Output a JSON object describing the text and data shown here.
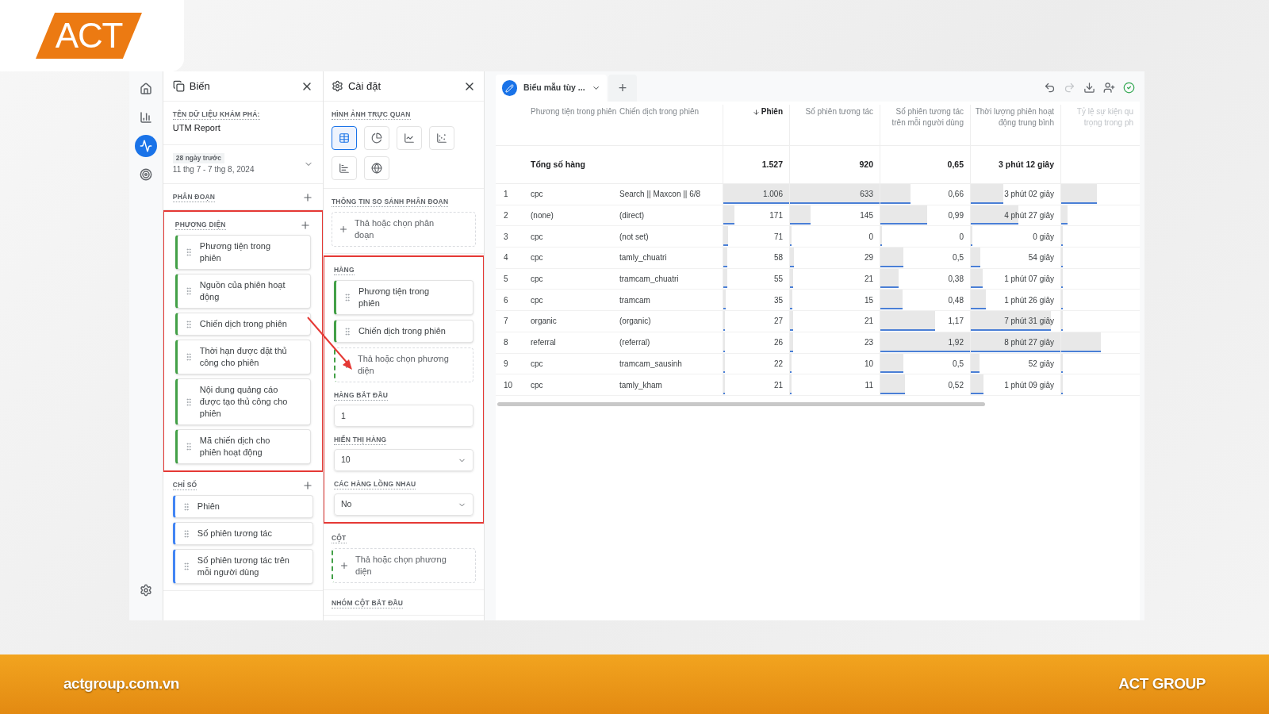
{
  "logo": {
    "text": "ACT"
  },
  "rail": {
    "items": [
      {
        "kind": "home",
        "selected": false
      },
      {
        "kind": "reports",
        "selected": false
      },
      {
        "kind": "explore",
        "selected": true
      },
      {
        "kind": "advertising",
        "selected": false
      }
    ],
    "bottom_items": [
      {
        "kind": "settings",
        "selected": false
      }
    ]
  },
  "variables_panel": {
    "title": "Biến",
    "exploration_name_label": "TÊN DỮ LIỆU KHÁM PHÁ:",
    "exploration_name": "UTM Report",
    "date_chip": "28 ngày trước",
    "date_range": "11 thg 7 - 7 thg 8, 2024",
    "sections": [
      {
        "label": "PHÂN ĐOẠN",
        "highlighted": false
      },
      {
        "label": "PHƯƠNG DIỆN",
        "highlighted": true,
        "items": [
          {
            "kind": "dimension",
            "label": "Phương tiện trong phiên"
          },
          {
            "kind": "dimension",
            "label": "Nguồn của phiên hoạt động"
          },
          {
            "kind": "dimension",
            "label": "Chiến dịch trong phiên"
          },
          {
            "kind": "dimension",
            "label": "Thời hạn được đặt thủ công cho phiên"
          },
          {
            "kind": "dimension",
            "label": "Nội dung quảng cáo được tạo thủ công cho phiên"
          },
          {
            "kind": "dimension",
            "label": "Mã chiến dịch cho phiên hoạt động"
          }
        ]
      },
      {
        "label": "CHỈ SỐ",
        "highlighted": false,
        "items": [
          {
            "kind": "metric",
            "label": "Phiên"
          },
          {
            "kind": "metric",
            "label": "Số phiên tương tác"
          },
          {
            "kind": "metric",
            "label": "Số phiên tương tác trên mỗi người dùng"
          }
        ]
      }
    ]
  },
  "settings_panel": {
    "title": "Cài đặt",
    "visualization_label": "HÌNH ẢNH TRỰC QUAN",
    "visualizations": [
      {
        "kind": "table",
        "selected": true
      },
      {
        "kind": "donut",
        "selected": false
      },
      {
        "kind": "line",
        "selected": false
      },
      {
        "kind": "scatter",
        "selected": false
      },
      {
        "kind": "bar",
        "selected": false
      },
      {
        "kind": "geo",
        "selected": false
      }
    ],
    "blocks": [
      {
        "kind": "dropzone",
        "label": "THÔNG TIN SO SÁNH PHÂN ĐOẠN",
        "highlighted": false,
        "drop_text": "Thả hoặc chọn phân đoạn",
        "dashed_accent": false
      },
      {
        "kind": "rows",
        "label": "HÀNG",
        "highlighted": true,
        "items": [
          {
            "kind": "dimension",
            "label": "Phương tiện trong phiên"
          },
          {
            "kind": "dimension",
            "label": "Chiến dịch trong phiên"
          }
        ],
        "drop_text": "Thả hoặc chọn phương diện",
        "dashed_accent": true,
        "fields": [
          {
            "kind": "input",
            "label": "HÀNG BẮT ĐẦU",
            "value": "1"
          },
          {
            "kind": "select",
            "label": "HIỂN THỊ HÀNG",
            "value": "10"
          },
          {
            "kind": "select",
            "label": "CÁC HÀNG LỒNG NHAU",
            "value": "No"
          }
        ]
      },
      {
        "kind": "dropzone",
        "label": "CỘT",
        "highlighted": false,
        "drop_text": "Thả hoặc chọn phương diện",
        "dashed_accent": true
      },
      {
        "kind": "label",
        "label": "NHÓM CỘT BẮT ĐẦU",
        "highlighted": false
      }
    ]
  },
  "tabs": [
    {
      "label": "Biểu mẫu tùy ...",
      "selected": true
    }
  ],
  "add_tab": "+",
  "toolbar": [
    {
      "kind": "undo",
      "disabled": false
    },
    {
      "kind": "redo",
      "disabled": true
    },
    {
      "kind": "download",
      "disabled": false
    },
    {
      "kind": "share",
      "disabled": false
    },
    {
      "kind": "status",
      "disabled": false
    }
  ],
  "table": {
    "dimension_columns": [
      "Phương tiện trong phiên",
      "Chiến dịch trong phiên"
    ],
    "metric_columns": [
      {
        "label": "Phiên",
        "sorted": true
      },
      {
        "label": "Số phiên tương tác",
        "sorted": false
      },
      {
        "label": "Số phiên tương tác trên mỗi người dùng",
        "sorted": false
      },
      {
        "label": "Thời lượng phiên hoạt động trung bình",
        "sorted": false
      },
      {
        "label": "Tỷ lệ sự kiện qu\ntrọng trong ph",
        "sorted": false
      }
    ],
    "total_label": "Tổng số hàng",
    "totals": [
      "1.527",
      "920",
      "0,65",
      "3 phút 12 giây"
    ],
    "rows": [
      {
        "index": "1",
        "medium": "cpc",
        "campaign": "Search || Maxcon || 6/8",
        "cells": [
          {
            "value": "1.006",
            "level": 1
          },
          {
            "value": "633",
            "level": 1
          },
          {
            "value": "0,66",
            "level": 0.34
          },
          {
            "value": "3 phút 02 giây",
            "level": 0.36
          },
          {
            "level": 0.45
          }
        ]
      },
      {
        "index": "2",
        "medium": "(none)",
        "campaign": "(direct)",
        "cells": [
          {
            "value": "171",
            "level": 0.17
          },
          {
            "value": "145",
            "level": 0.23
          },
          {
            "value": "0,99",
            "level": 0.52
          },
          {
            "value": "4 phút 27 giây",
            "level": 0.53
          },
          {
            "level": 0.08
          }
        ]
      },
      {
        "index": "3",
        "medium": "cpc",
        "campaign": "(not set)",
        "cells": [
          {
            "value": "71",
            "level": 0.07
          },
          {
            "value": "0",
            "level": 0
          },
          {
            "value": "0",
            "level": 0
          },
          {
            "value": "0 giây",
            "level": 0
          },
          {
            "level": 0
          }
        ]
      },
      {
        "index": "4",
        "medium": "cpc",
        "campaign": "tamly_chuatri",
        "cells": [
          {
            "value": "58",
            "level": 0.058
          },
          {
            "value": "29",
            "level": 0.046
          },
          {
            "value": "0,5",
            "level": 0.26
          },
          {
            "value": "54 giây",
            "level": 0.11
          },
          {
            "level": 0
          }
        ]
      },
      {
        "index": "5",
        "medium": "cpc",
        "campaign": "tramcam_chuatri",
        "cells": [
          {
            "value": "55",
            "level": 0.055
          },
          {
            "value": "21",
            "level": 0.033
          },
          {
            "value": "0,38",
            "level": 0.2
          },
          {
            "value": "1 phút 07 giây",
            "level": 0.13
          },
          {
            "level": 0
          }
        ]
      },
      {
        "index": "6",
        "medium": "cpc",
        "campaign": "tramcam",
        "cells": [
          {
            "value": "35",
            "level": 0.035
          },
          {
            "value": "15",
            "level": 0.024
          },
          {
            "value": "0,48",
            "level": 0.25
          },
          {
            "value": "1 phút 26 giây",
            "level": 0.17
          },
          {
            "level": 0
          }
        ]
      },
      {
        "index": "7",
        "medium": "organic",
        "campaign": "(organic)",
        "cells": [
          {
            "value": "27",
            "level": 0.027
          },
          {
            "value": "21",
            "level": 0.033
          },
          {
            "value": "1,17",
            "level": 0.61
          },
          {
            "value": "7 phút 31 giây",
            "level": 0.89
          },
          {
            "level": 0
          }
        ]
      },
      {
        "index": "8",
        "medium": "referral",
        "campaign": "(referral)",
        "cells": [
          {
            "value": "26",
            "level": 0.026
          },
          {
            "value": "23",
            "level": 0.036
          },
          {
            "value": "1,92",
            "level": 1
          },
          {
            "value": "8 phút 27 giây",
            "level": 1
          },
          {
            "level": 0.5
          }
        ]
      },
      {
        "index": "9",
        "medium": "cpc",
        "campaign": "tramcam_sausinh",
        "cells": [
          {
            "value": "22",
            "level": 0.022
          },
          {
            "value": "10",
            "level": 0.016
          },
          {
            "value": "0,5",
            "level": 0.26
          },
          {
            "value": "52 giây",
            "level": 0.1
          },
          {
            "level": 0
          }
        ]
      },
      {
        "index": "10",
        "medium": "cpc",
        "campaign": "tamly_kham",
        "cells": [
          {
            "value": "21",
            "level": 0.021
          },
          {
            "value": "11",
            "level": 0.017
          },
          {
            "value": "0,52",
            "level": 0.27
          },
          {
            "value": "1 phút 09 giây",
            "level": 0.14
          },
          {
            "level": 0
          }
        ]
      }
    ]
  },
  "footer": {
    "website": "actgroup.com.vn",
    "brand": "ACT GROUP"
  }
}
